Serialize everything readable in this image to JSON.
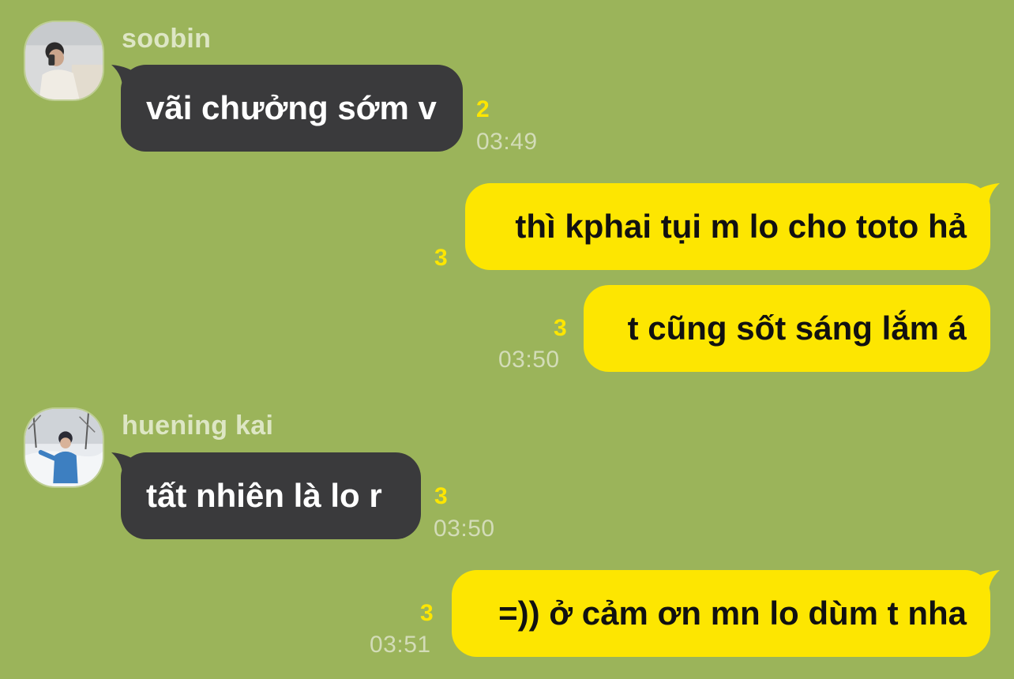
{
  "colors": {
    "background": "#9bb45a",
    "incoming_bubble": "#3a3a3c",
    "outgoing_bubble": "#fde601",
    "unread_count": "#fde601",
    "timestamp": "#d3dcb8"
  },
  "messages": [
    {
      "direction": "incoming",
      "sender": "soobin",
      "avatar": "soobin-avatar",
      "text": "vãi chưởng sớm v",
      "unread": "2",
      "time": "03:49"
    },
    {
      "direction": "outgoing",
      "text": "thì kphai tụi m lo cho toto hả",
      "unread": "3",
      "time": ""
    },
    {
      "direction": "outgoing",
      "text": "t cũng sốt sáng lắm á",
      "unread": "3",
      "time": "03:50"
    },
    {
      "direction": "incoming",
      "sender": "huening kai",
      "avatar": "huening-kai-avatar",
      "text": "tất nhiên là lo r",
      "unread": "3",
      "time": "03:50"
    },
    {
      "direction": "outgoing",
      "text": "=)) ở cảm ơn mn lo dùm t nha",
      "unread": "3",
      "time": "03:51"
    }
  ]
}
